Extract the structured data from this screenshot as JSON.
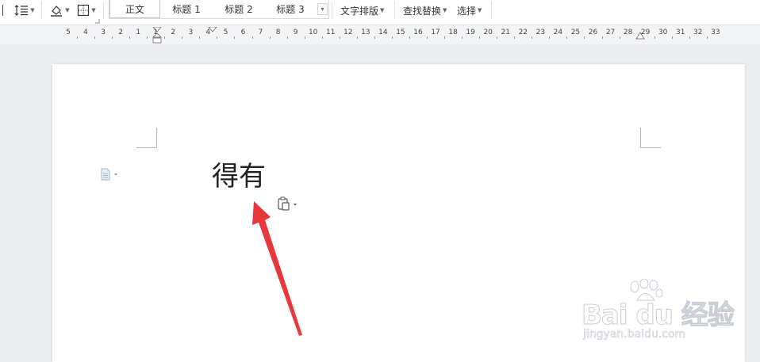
{
  "toolbar": {
    "styles": [
      "正文",
      "标题 1",
      "标题 2",
      "标题 3"
    ],
    "selected_style": "正文",
    "menus": [
      "文字排版",
      "查找替换",
      "选择"
    ],
    "icons": [
      "line-spacing-icon",
      "shading-icon",
      "borders-icon"
    ]
  },
  "ruler": {
    "numbers": [
      "5",
      "4",
      "3",
      "2",
      "1",
      "1",
      "2",
      "3",
      "4",
      "5",
      "6",
      "7",
      "8",
      "9",
      "10",
      "11",
      "12",
      "13",
      "14",
      "15",
      "16",
      "17",
      "18",
      "19",
      "20",
      "21",
      "22",
      "23",
      "24",
      "25",
      "26",
      "27",
      "28",
      "29",
      "30",
      "31",
      "32",
      "33"
    ]
  },
  "document": {
    "text": "得有"
  },
  "watermark": {
    "main": "Bai du 经验",
    "sub": "jingyan.baidu.com"
  },
  "colors": {
    "arrow": "#e8383b",
    "page": "#ffffff",
    "workspace": "#ebedf0"
  }
}
